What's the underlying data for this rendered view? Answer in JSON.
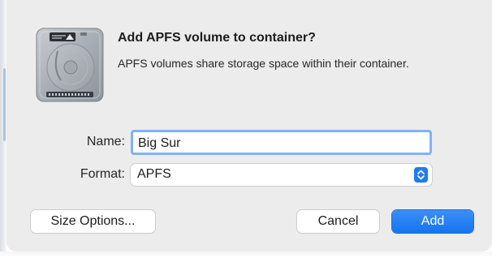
{
  "dialog": {
    "title": "Add APFS volume to container?",
    "message": "APFS volumes share storage space within their container.",
    "icon": "disk-drive-icon"
  },
  "form": {
    "name_label": "Name:",
    "name_value": "Big Sur",
    "format_label": "Format:",
    "format_value": "APFS"
  },
  "buttons": {
    "size_options": "Size Options...",
    "cancel": "Cancel",
    "add": "Add"
  },
  "colors": {
    "accent": "#1574ee",
    "focus_ring": "#7fb3f5",
    "dialog_background": "#ececec"
  }
}
